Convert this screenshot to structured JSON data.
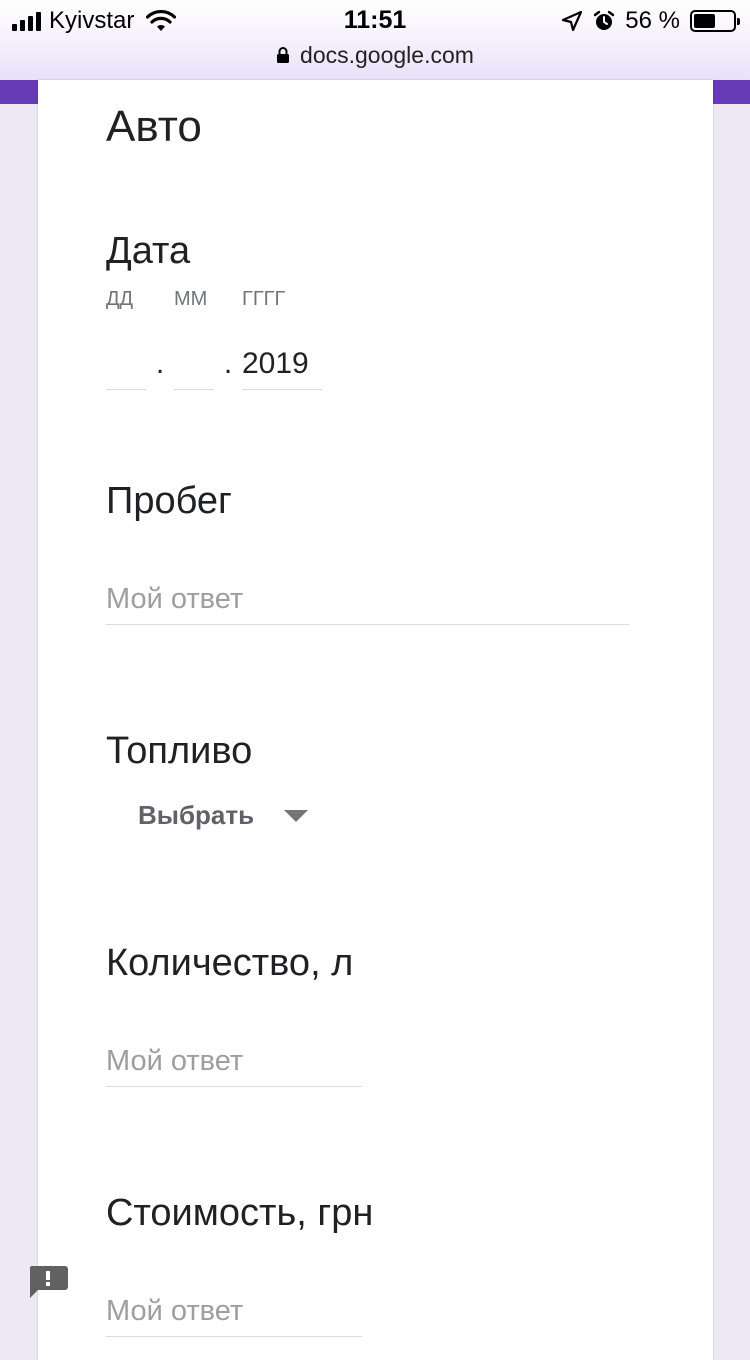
{
  "status_bar": {
    "carrier": "Kyivstar",
    "time": "11:51",
    "battery_percent": "56 %",
    "battery_level": 0.56
  },
  "browser": {
    "url": "docs.google.com"
  },
  "form": {
    "section_title": "Авто",
    "date": {
      "label": "Дата",
      "day_label": "ДД",
      "month_label": "ММ",
      "year_label": "ГГГГ",
      "day_value": "",
      "month_value": "",
      "year_value": "2019",
      "separator": "."
    },
    "mileage": {
      "label": "Пробег",
      "placeholder": "Мой ответ"
    },
    "fuel": {
      "label": "Топливо",
      "select_value": "Выбрать"
    },
    "quantity": {
      "label": "Количество, л",
      "placeholder": "Мой ответ"
    },
    "cost": {
      "label": "Стоимость, грн",
      "placeholder": "Мой ответ"
    }
  },
  "colors": {
    "accent": "#673ab7",
    "background": "#ede7f6"
  }
}
